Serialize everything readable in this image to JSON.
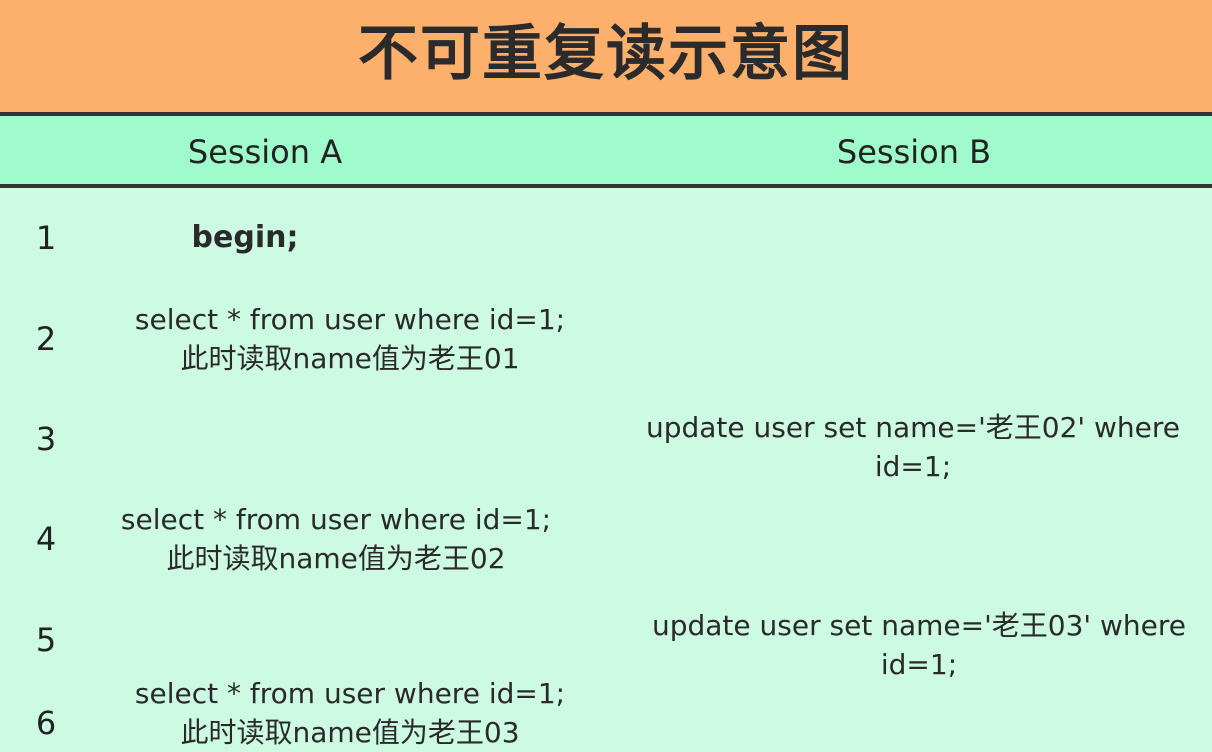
{
  "title": "不可重复读示意图",
  "headers": {
    "session_a": "Session A",
    "session_b": "Session B"
  },
  "rows": [
    {
      "num": "1",
      "a": [
        "begin;"
      ],
      "b": []
    },
    {
      "num": "2",
      "a": [
        "select * from user where id=1;",
        "此时读取name值为老王01"
      ],
      "b": []
    },
    {
      "num": "3",
      "a": [],
      "b": [
        "update user set name='老王02' where",
        "id=1;"
      ]
    },
    {
      "num": "4",
      "a": [
        "select * from user where id=1;",
        "此时读取name值为老王02"
      ],
      "b": []
    },
    {
      "num": "5",
      "a": [],
      "b": [
        "update user set name='老王03' where",
        "id=1;"
      ]
    },
    {
      "num": "6",
      "a": [
        "select * from user where id=1;",
        "此时读取name值为老王03"
      ],
      "b": []
    }
  ],
  "colors": {
    "title_bg": "#fdb06c",
    "header_bg": "#9ffbcc",
    "body_bg": "#ccfae2",
    "divider": "#333333"
  }
}
